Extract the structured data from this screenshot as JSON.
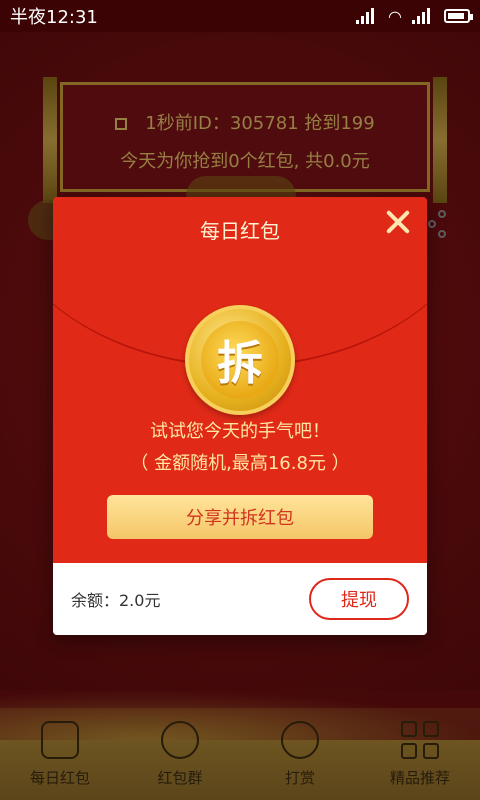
{
  "status_bar": {
    "time": "半夜12:31"
  },
  "banner": {
    "line1": "1秒前ID：305781 抢到199",
    "line2": "今天为你抢到0个红包, 共0.0元"
  },
  "dialog": {
    "title": "每日红包",
    "coin_char": "拆",
    "message": "试试您今天的手气吧！",
    "subtitle": "（ 金额随机,最高16.8元 ）",
    "share_button": "分享并拆红包",
    "balance": "余额：2.0元",
    "withdraw_button": "提现"
  },
  "bottom_nav": [
    {
      "label": "每日红包",
      "icon": "yen-card-icon"
    },
    {
      "label": "红包群",
      "icon": "group-icon"
    },
    {
      "label": "打赏",
      "icon": "yen-circle-icon"
    },
    {
      "label": "精品推荐",
      "icon": "grid-icon"
    }
  ],
  "colors": {
    "dialog_red": "#e02a17",
    "gold": "#f5c668",
    "status_bar": "#3b0304"
  }
}
